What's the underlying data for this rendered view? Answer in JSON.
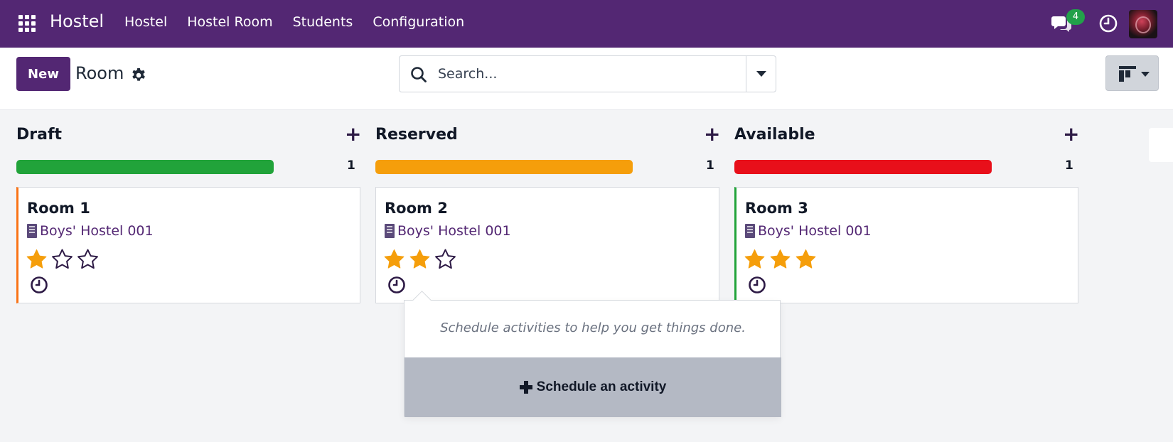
{
  "navbar": {
    "brand": "Hostel",
    "menu": [
      "Hostel",
      "Hostel Room",
      "Students",
      "Configuration"
    ],
    "messages_count": "4",
    "icons": {
      "apps": "apps-grid-icon",
      "messages": "chat-icon",
      "activities": "clock-icon"
    }
  },
  "control_panel": {
    "new_label": "New",
    "title": "Room",
    "search_placeholder": "Search..."
  },
  "columns": [
    {
      "title": "Draft",
      "count": "1",
      "bar_color": "#21a33a",
      "card": {
        "title": "Room 1",
        "hostel": "Boys' Hostel 001",
        "rating": 1,
        "edge_color": "#f97316"
      }
    },
    {
      "title": "Reserved",
      "count": "1",
      "bar_color": "#f59e0b",
      "card": {
        "title": "Room 2",
        "hostel": "Boys' Hostel 001",
        "rating": 2,
        "edge_color": ""
      }
    },
    {
      "title": "Available",
      "count": "1",
      "bar_color": "#e80f1a",
      "card": {
        "title": "Room 3",
        "hostel": "Boys' Hostel 001",
        "rating": 3,
        "edge_color": "#21a33a"
      }
    }
  ],
  "activity_popover": {
    "message": "Schedule activities to help you get things done.",
    "button_label": "Schedule an activity"
  },
  "colors": {
    "brand": "#532773",
    "star": "#f59e0b"
  }
}
